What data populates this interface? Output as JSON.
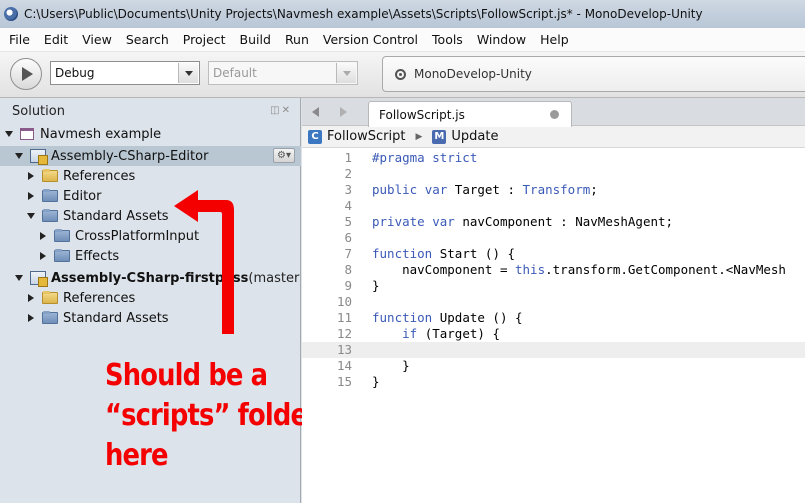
{
  "window": {
    "title": "C:\\Users\\Public\\Documents\\Unity Projects\\Navmesh example\\Assets\\Scripts\\FollowScript.js* - MonoDevelop-Unity"
  },
  "menu": [
    "File",
    "Edit",
    "View",
    "Search",
    "Project",
    "Build",
    "Run",
    "Version Control",
    "Tools",
    "Window",
    "Help"
  ],
  "toolbar": {
    "configuration": "Debug",
    "target": "Default",
    "status": "MonoDevelop-Unity"
  },
  "solution_pad": {
    "title": "Solution",
    "tree": [
      {
        "label": "Navmesh example",
        "icon": "solution-icon",
        "expander": "open",
        "indent": 0
      },
      {
        "label": "Assembly-CSharp-Editor",
        "icon": "project-icon",
        "expander": "open",
        "indent": 1,
        "selected": true
      },
      {
        "label": "References",
        "icon": "folder-yellow-icon",
        "expander": "closed",
        "indent": 2
      },
      {
        "label": "Editor",
        "icon": "folder-blue-icon",
        "expander": "closed",
        "indent": 2
      },
      {
        "label": "Standard Assets",
        "icon": "folder-blue-icon",
        "expander": "open",
        "indent": 2
      },
      {
        "label": "CrossPlatformInput",
        "icon": "folder-blue-icon",
        "expander": "closed",
        "indent": 3
      },
      {
        "label": "Effects",
        "icon": "folder-blue-icon",
        "expander": "closed",
        "indent": 3
      },
      {
        "label": "Assembly-CSharp-firstpass",
        "suffix": " (master",
        "icon": "project-icon",
        "expander": "open",
        "indent": 1,
        "bold": true
      },
      {
        "label": "References",
        "icon": "folder-yellow-icon",
        "expander": "closed",
        "indent": 2
      },
      {
        "label": "Standard Assets",
        "icon": "folder-blue-icon",
        "expander": "closed",
        "indent": 2
      }
    ]
  },
  "annotation": {
    "lines": [
      "Should be a",
      "“scripts” folder",
      "here"
    ],
    "color": "#f40000"
  },
  "editor": {
    "tab_label": "FollowScript.js",
    "path": {
      "class": "FollowScript",
      "member": "Update"
    },
    "current_line": 13,
    "lines": [
      {
        "n": "1",
        "text": "#pragma strict"
      },
      {
        "n": "2",
        "text": ""
      },
      {
        "n": "3",
        "text": "public var Target : Transform;"
      },
      {
        "n": "4",
        "text": ""
      },
      {
        "n": "5",
        "text": "private var navComponent : NavMeshAgent;"
      },
      {
        "n": "6",
        "text": ""
      },
      {
        "n": "7",
        "text": "function Start () {"
      },
      {
        "n": "8",
        "text": "    navComponent = this.transform.GetComponent.<NavMesh"
      },
      {
        "n": "9",
        "text": "}"
      },
      {
        "n": "10",
        "text": ""
      },
      {
        "n": "11",
        "text": "function Update () {"
      },
      {
        "n": "12",
        "text": "    if (Target) {"
      },
      {
        "n": "13",
        "text": ""
      },
      {
        "n": "14",
        "text": "    }"
      },
      {
        "n": "15",
        "text": "}"
      }
    ]
  },
  "colors": {
    "keyword": "#3b5ab8",
    "line_number": "#8a8a8a",
    "selection": "#b9c7d2"
  }
}
